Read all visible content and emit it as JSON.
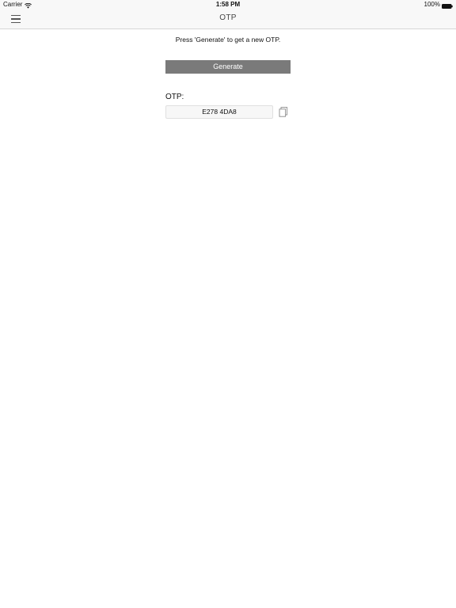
{
  "status_bar": {
    "carrier": "Carrier",
    "time": "1:58 PM",
    "battery": "100%",
    "icons": [
      "wifi-icon",
      "battery-icon"
    ]
  },
  "nav_bar": {
    "title": "OTP",
    "menu_icon": "hamburger-menu-icon"
  },
  "content": {
    "instruction": "Press 'Generate' to get a new OTP.",
    "generate_label": "Generate",
    "otp_label": "OTP:",
    "otp_value": "E278 4DA8",
    "copy_icon": "copy-icon"
  },
  "colors": {
    "button_bg": "#7a7a7a",
    "button_text": "#ffffff",
    "field_bg": "#f7f7f7",
    "navbar_bg": "#f8f8f8"
  }
}
